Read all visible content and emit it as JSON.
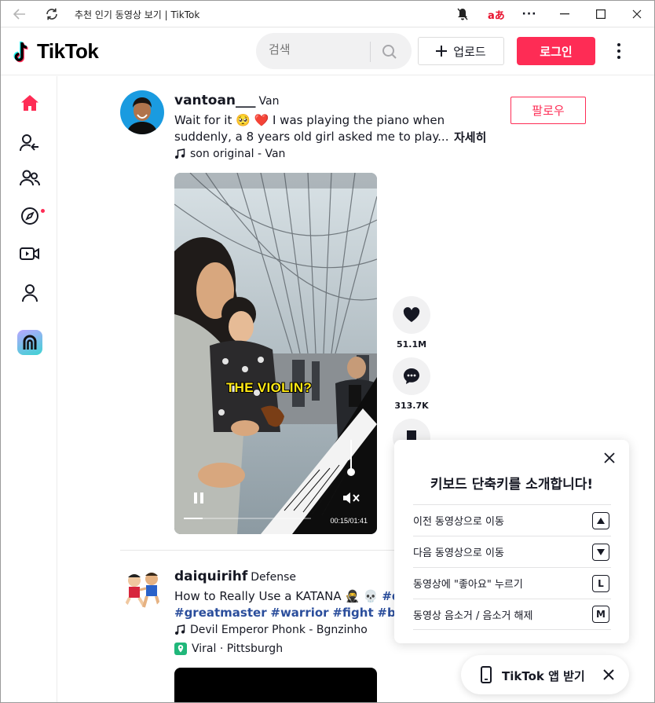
{
  "window": {
    "title": "추천 인기 동영상 보기 | TikTok",
    "ext_translate": "aあ"
  },
  "header": {
    "logo": "TikTok",
    "search_placeholder": "검색",
    "upload_label": "업로드",
    "login_label": "로그인"
  },
  "colors": {
    "brand": "#fe2c55",
    "hashtag": "#2b4e9c"
  },
  "sidebar": {
    "items": [
      {
        "icon": "home-icon"
      },
      {
        "icon": "following-icon"
      },
      {
        "icon": "friends-icon"
      },
      {
        "icon": "explore-icon"
      },
      {
        "icon": "live-icon"
      },
      {
        "icon": "profile-icon"
      },
      {
        "icon": "app-icon"
      }
    ]
  },
  "post1": {
    "username": "vantoan___",
    "nickname": "Van",
    "desc_line1": "Wait for it 🥺 ❤️ I was playing the piano when",
    "desc_line2": "suddenly, a 8 years old girl asked me to play...",
    "more": "자세히",
    "music": "son original - Van",
    "follow": "팔로우",
    "video_caption": "THE VIOLIN?",
    "video_time": "00:15/01:41",
    "progress": 0.15,
    "likes": "51.1M",
    "comments": "313.7K"
  },
  "post2": {
    "username": "daiquirihf",
    "nickname": "Defense",
    "desc_line1": "How to Really Use a KATANA 🥷 💀",
    "desc_tag_partial": "#d",
    "tags": [
      "#greatmaster",
      "#warrior",
      "#fight",
      "#boxing"
    ],
    "music": "Devil Emperor Phonk - Bgnzinho",
    "location": "Viral · Pittsburgh"
  },
  "shortcuts": {
    "title": "키보드 단축키를 소개합니다!",
    "rows": [
      {
        "label": "이전 동영상으로 이동",
        "key": "▲"
      },
      {
        "label": "다음 동영상으로 이동",
        "key": "▼"
      },
      {
        "label": "동영상에 \"좋아요\" 누르기",
        "key": "L"
      },
      {
        "label": "동영상 음소거 / 음소거 해제",
        "key": "M"
      }
    ]
  },
  "getapp": {
    "label": "TikTok 앱 받기"
  }
}
